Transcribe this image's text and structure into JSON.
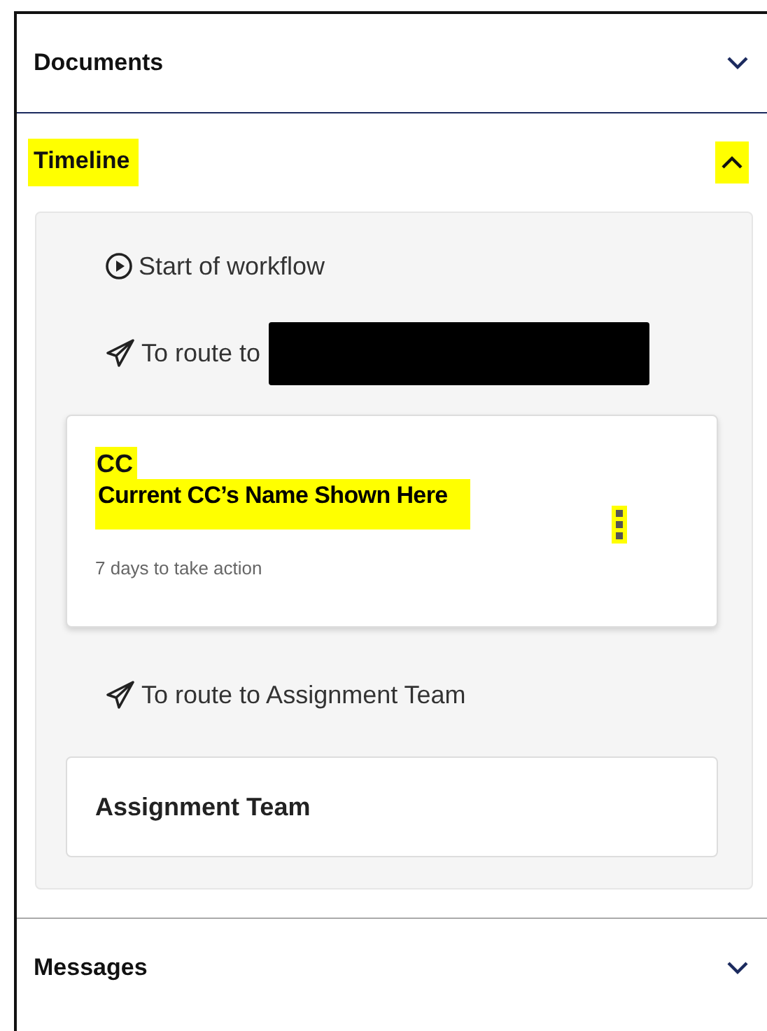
{
  "sections": [
    {
      "title": "Documents",
      "expanded": false,
      "highlighted": false
    },
    {
      "title": "Timeline",
      "expanded": true,
      "highlighted": true,
      "timeline": [
        {
          "kind": "start",
          "text": "Start of workflow",
          "redacted": false
        },
        {
          "kind": "route",
          "text": "To route to",
          "redacted": true
        },
        {
          "kind": "card",
          "role": "CC",
          "name": "Current CC’s Name Shown Here",
          "note": "7 days to take action",
          "highlighted": true
        },
        {
          "kind": "route",
          "text": "To route to Assignment Team",
          "redacted": false
        },
        {
          "kind": "card",
          "title": "Assignment Team"
        }
      ]
    },
    {
      "title": "Messages",
      "expanded": false,
      "highlighted": false
    }
  ]
}
